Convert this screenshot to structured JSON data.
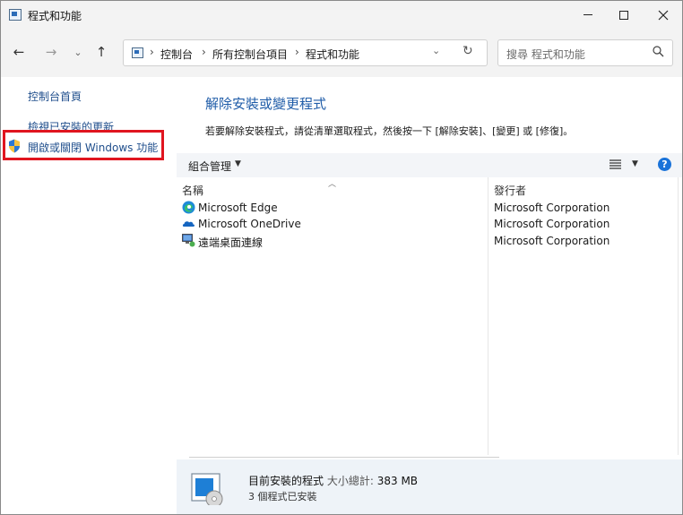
{
  "window": {
    "title": "程式和功能"
  },
  "nav": {
    "back": "←",
    "forward": "→",
    "recent": "⌄",
    "up": "↑",
    "breadcrumb": [
      "控制台",
      "所有控制台項目",
      "程式和功能"
    ],
    "separator": "›",
    "dropdown": "⌄",
    "refresh": "↻"
  },
  "search": {
    "placeholder": "搜尋 程式和功能"
  },
  "left": {
    "home": "控制台首頁",
    "updates": "檢視已安裝的更新",
    "features": "開啟或關閉 Windows 功能"
  },
  "main": {
    "title": "解除安裝或變更程式",
    "description": "若要解除安裝程式，請從清單選取程式，然後按一下 [解除安裝]、[變更] 或 [修復]。"
  },
  "toolbar": {
    "organize": "組合管理",
    "arrow": "▼",
    "help": "?"
  },
  "columns": {
    "name": "名稱",
    "publisher": "發行者"
  },
  "programs": [
    {
      "name": "Microsoft Edge",
      "publisher": "Microsoft Corporation",
      "icon": "edge-icon"
    },
    {
      "name": "Microsoft OneDrive",
      "publisher": "Microsoft Corporation",
      "icon": "onedrive-icon"
    },
    {
      "name": "遠端桌面連線",
      "publisher": "Microsoft Corporation",
      "icon": "remote-desktop-icon"
    }
  ],
  "status": {
    "label": "目前安裝的程式",
    "size_label": "大小總計:",
    "size_value": "383 MB",
    "count_text": "3 個程式已安裝"
  },
  "colors": {
    "link": "#1f4e8c",
    "title_blue": "#1f5ca8",
    "highlight": "#e0151f",
    "help": "#1a73d9"
  }
}
